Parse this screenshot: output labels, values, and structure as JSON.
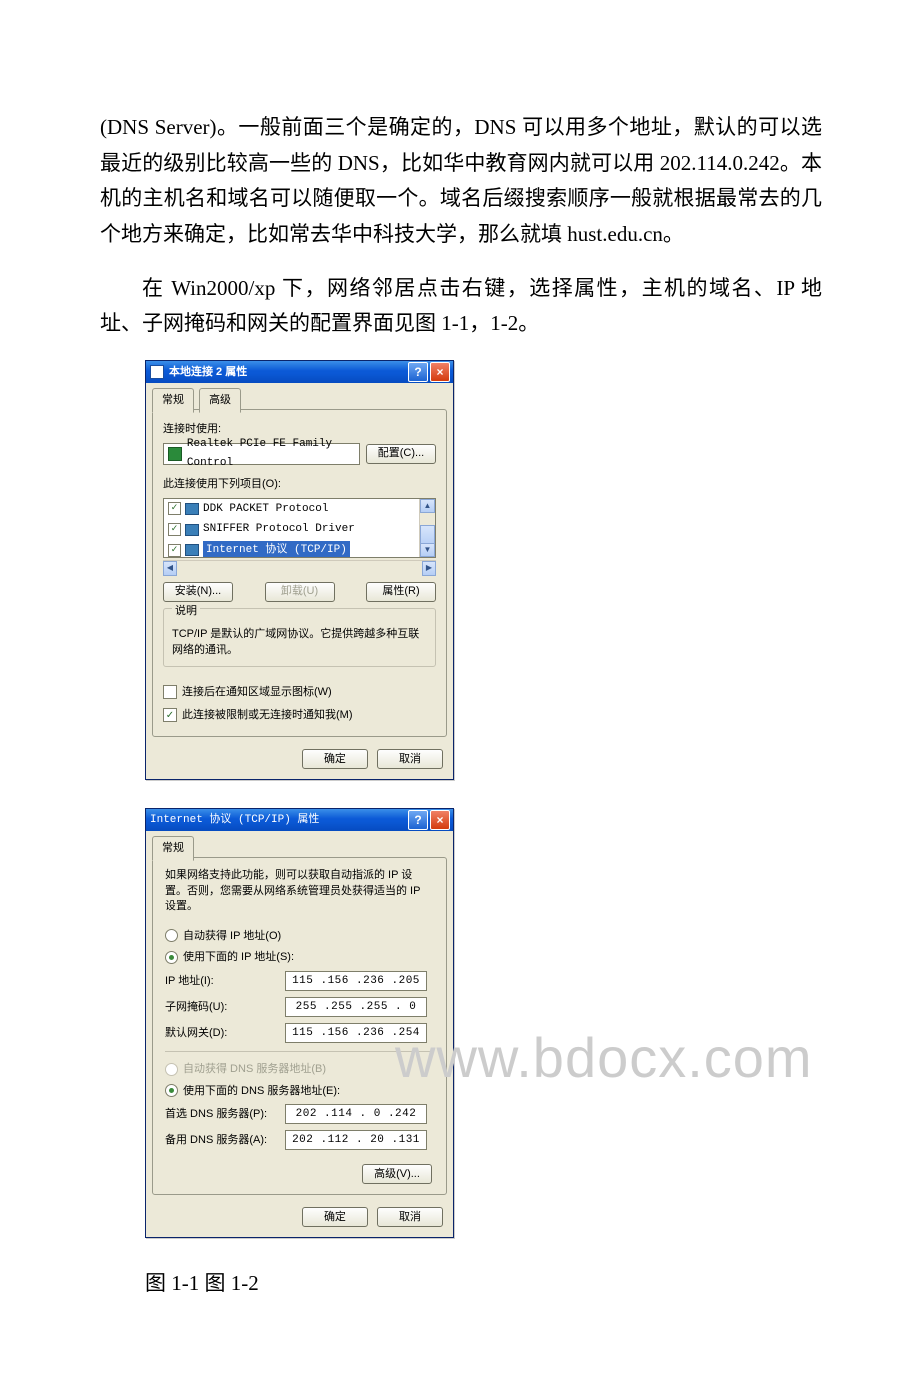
{
  "para1": "(DNS Server)。一般前面三个是确定的，DNS 可以用多个地址，默认的可以选最近的级别比较高一些的 DNS，比如华中教育网内就可以用 202.114.0.242。本机的主机名和域名可以随便取一个。域名后缀搜索顺序一般就根据最常去的几个地方来确定，比如常去华中科技大学，那么就填 hust.edu.cn。",
  "para2": "在 Win2000/xp 下，网络邻居点击右键，选择属性，主机的域名、IP 地址、子网掩码和网关的配置界面见图 1-1，1-2。",
  "watermark": "www.bdocx.com",
  "caption": "图 1-1 图 1-2",
  "dlg1": {
    "title": "本地连接 2 属性",
    "help": "?",
    "close": "×",
    "tabs": {
      "general": "常规",
      "advanced": "高级"
    },
    "connect_using": "连接时使用:",
    "adapter": "Realtek PCIe FE Family Control",
    "configure": "配置(C)...",
    "items_label": "此连接使用下列项目(O):",
    "items": [
      "DDK PACKET Protocol",
      "SNIFFER Protocol Driver",
      "Internet 协议 (TCP/IP)"
    ],
    "install": "安装(N)...",
    "uninstall": "卸载(U)",
    "properties": "属性(R)",
    "desc_title": "说明",
    "desc_text": "TCP/IP 是默认的广域网协议。它提供跨越多种互联网络的通讯。",
    "check1": "连接后在通知区域显示图标(W)",
    "check2": "此连接被限制或无连接时通知我(M)",
    "ok": "确定",
    "cancel": "取消"
  },
  "dlg2": {
    "title": "Internet 协议 (TCP/IP) 属性",
    "help": "?",
    "close": "×",
    "tab_general": "常规",
    "intro": "如果网络支持此功能，则可以获取自动指派的 IP 设置。否则，您需要从网络系统管理员处获得适当的 IP 设置。",
    "radio_auto_ip": "自动获得 IP 地址(O)",
    "radio_use_ip": "使用下面的 IP 地址(S):",
    "ip_label": "IP 地址(I):",
    "ip_value": "115 .156 .236 .205",
    "mask_label": "子网掩码(U):",
    "mask_value": "255 .255 .255 .  0",
    "gw_label": "默认网关(D):",
    "gw_value": "115 .156 .236 .254",
    "radio_auto_dns": "自动获得 DNS 服务器地址(B)",
    "radio_use_dns": "使用下面的 DNS 服务器地址(E):",
    "dns1_label": "首选 DNS 服务器(P):",
    "dns1_value": "202 .114 .  0 .242",
    "dns2_label": "备用 DNS 服务器(A):",
    "dns2_value": "202 .112 . 20 .131",
    "advanced": "高级(V)...",
    "ok": "确定",
    "cancel": "取消"
  }
}
